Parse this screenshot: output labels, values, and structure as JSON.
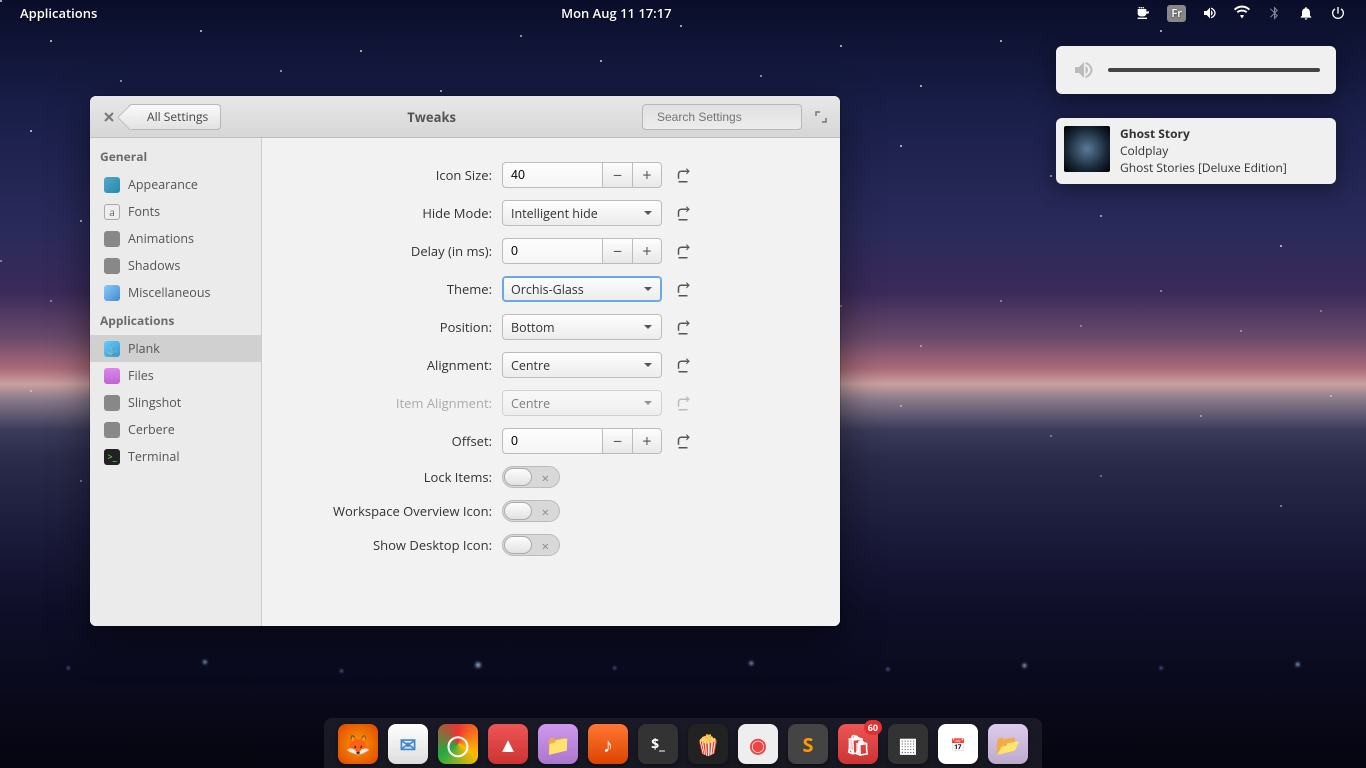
{
  "panel": {
    "applications": "Applications",
    "clock": "Mon Aug 11   17:17",
    "lang": "Fr"
  },
  "volume": {
    "level": 100
  },
  "nowplaying": {
    "title": "Ghost Story",
    "artist": "Coldplay",
    "album": "Ghost Stories [Deluxe Edition]"
  },
  "window": {
    "back": "All Settings",
    "title": "Tweaks",
    "search_placeholder": "Search Settings"
  },
  "sidebar": {
    "cat_general": "General",
    "general": [
      {
        "label": "Appearance",
        "icon": "appearance"
      },
      {
        "label": "Fonts",
        "icon": "fonts"
      },
      {
        "label": "Animations",
        "icon": "animations"
      },
      {
        "label": "Shadows",
        "icon": "shadows"
      },
      {
        "label": "Miscellaneous",
        "icon": "misc"
      }
    ],
    "cat_applications": "Applications",
    "applications": [
      {
        "label": "Plank",
        "icon": "plank",
        "active": true
      },
      {
        "label": "Files",
        "icon": "files"
      },
      {
        "label": "Slingshot",
        "icon": "slingshot"
      },
      {
        "label": "Cerbere",
        "icon": "cerbere"
      },
      {
        "label": "Terminal",
        "icon": "terminal"
      }
    ]
  },
  "settings": {
    "icon_size_label": "Icon Size:",
    "icon_size": "40",
    "hide_mode_label": "Hide Mode:",
    "hide_mode": "Intelligent hide",
    "delay_label": "Delay (in ms):",
    "delay": "0",
    "theme_label": "Theme:",
    "theme": "Orchis-Glass",
    "position_label": "Position:",
    "position": "Bottom",
    "alignment_label": "Alignment:",
    "alignment": "Centre",
    "item_alignment_label": "Item Alignment:",
    "item_alignment": "Centre",
    "offset_label": "Offset:",
    "offset": "0",
    "lock_items_label": "Lock Items:",
    "workspace_icon_label": "Workspace Overview Icon:",
    "show_desktop_label": "Show Desktop Icon:"
  },
  "dock": {
    "badge": "60",
    "apps": [
      "firefox",
      "mail",
      "chrome",
      "photos",
      "files",
      "music",
      "terminal",
      "popcorn",
      "launcher",
      "sublime",
      "software",
      "workspaces",
      "calendar",
      "folder"
    ]
  }
}
